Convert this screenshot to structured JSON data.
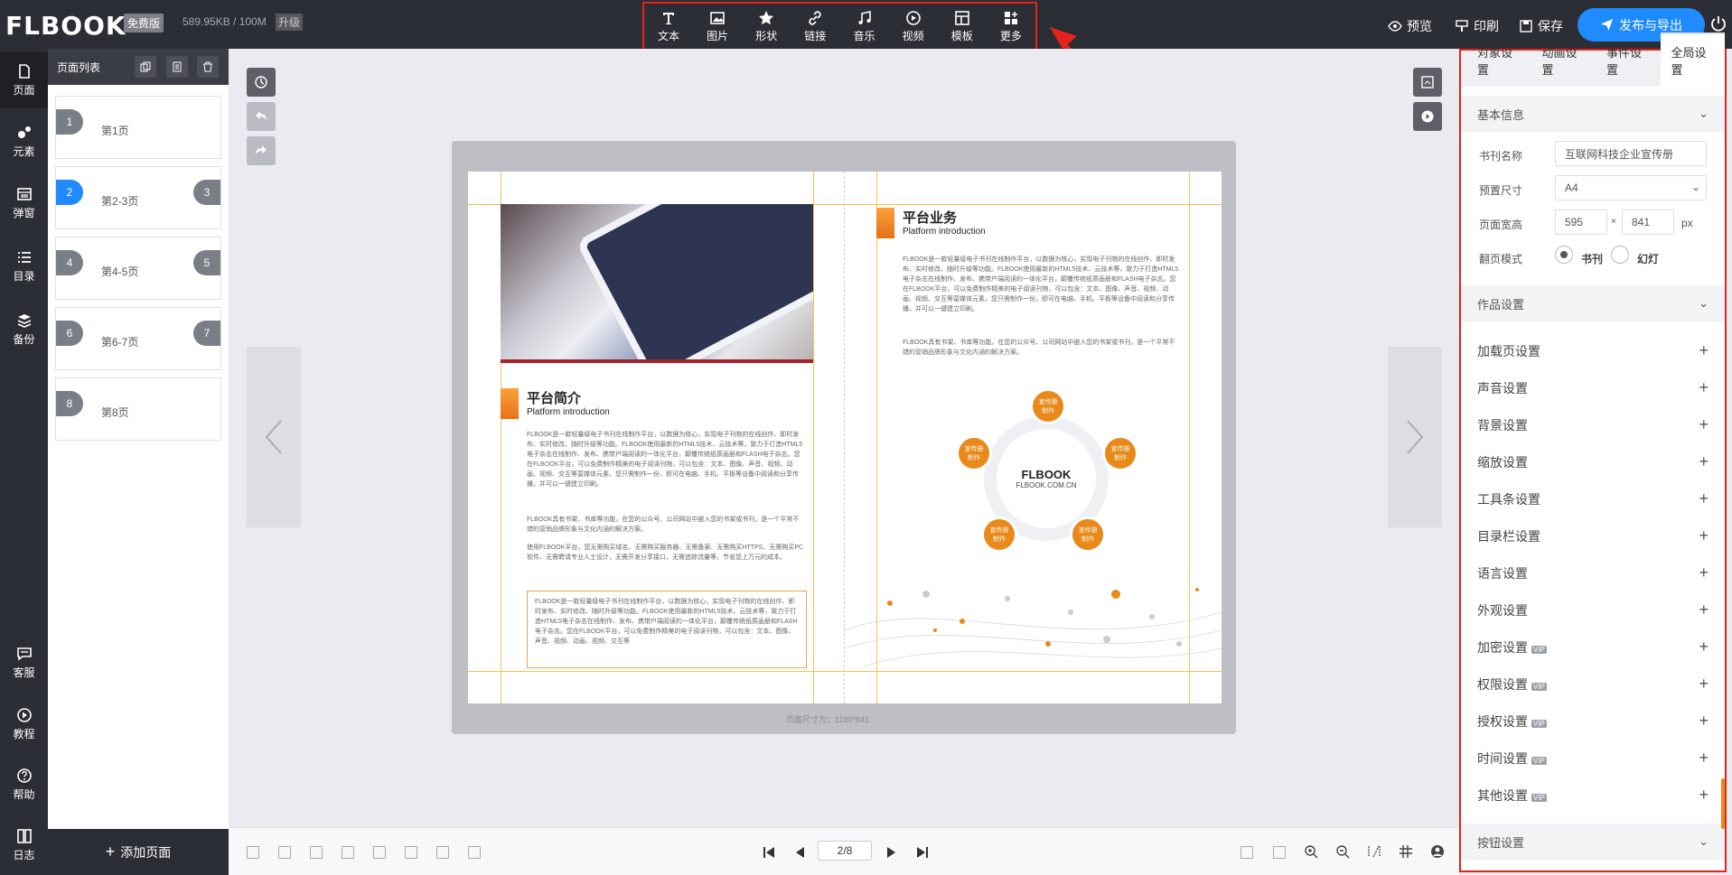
{
  "header": {
    "logo": "FLBOOK",
    "plan_badge": "免费版",
    "storage": "589.95KB / 100M",
    "upgrade": "升级",
    "tools": [
      {
        "label": "文本",
        "icon": "text-icon"
      },
      {
        "label": "图片",
        "icon": "image-icon"
      },
      {
        "label": "形状",
        "icon": "star-icon"
      },
      {
        "label": "链接",
        "icon": "link-icon"
      },
      {
        "label": "音乐",
        "icon": "music-icon"
      },
      {
        "label": "视频",
        "icon": "video-icon"
      },
      {
        "label": "模板",
        "icon": "template-icon"
      },
      {
        "label": "更多",
        "icon": "more-icon"
      }
    ],
    "preview": "预览",
    "print": "印刷",
    "save": "保存",
    "publish": "发布与导出"
  },
  "sidebar": {
    "items": [
      {
        "label": "页面",
        "icon": "page-icon"
      },
      {
        "label": "元素",
        "icon": "element-icon"
      },
      {
        "label": "弹窗",
        "icon": "popup-icon"
      },
      {
        "label": "目录",
        "icon": "list-icon"
      },
      {
        "label": "备份",
        "icon": "stack-icon"
      }
    ],
    "bottom_items": [
      {
        "label": "客服",
        "icon": "chat-icon"
      },
      {
        "label": "教程",
        "icon": "play-icon"
      },
      {
        "label": "帮助",
        "icon": "help-icon"
      },
      {
        "label": "日志",
        "icon": "log-icon"
      }
    ]
  },
  "page_list": {
    "title": "页面列表",
    "pages": [
      {
        "num": "1",
        "label": "第1页",
        "num2": ""
      },
      {
        "num": "2",
        "label": "第2-3页",
        "num2": "3"
      },
      {
        "num": "4",
        "label": "第4-5页",
        "num2": "5"
      },
      {
        "num": "6",
        "label": "第6-7页",
        "num2": "7"
      },
      {
        "num": "8",
        "label": "第8页",
        "num2": ""
      }
    ],
    "add_page": "添加页面"
  },
  "book": {
    "left": {
      "title_cn": "平台简介",
      "title_en": "Platform introduction",
      "para1": "FLBOOK是一款轻量级电子书刊在线制作平台，以数据为核心，实现电子刊物的在线创作、即时发布、实时修改、随时升级等功能。FLBOOK使用最新的HTML5技术、云技术等，致力于打造HTML5电子杂志在线制作、发布、携带户端阅读的一体化平台，颠覆传统纸质画册和FLASH电子杂志。您在FLBOOK平台，可以免费制作精美的电子阅读刊物，可以包含：文本、图像、声音、视频、动画、视频、交互等富媒体元素。您只需制作一份，即可在电脑、手机、平板等设备中阅读和分享传播，并可以一键建立印刷。",
      "para2": "FLBOOK具有书架、书库等功能，在您的公众号、公司网站中嵌入您的书架或书刊，是一个平常不错的营销品牌形象与文化内涵的解决方案。",
      "para3": "使用FLBOOK平台，您无需购买域名、无需购买服务器、无需备案、无需购买HTTPS、无需购买PC软件、无需聘请专业人士设计，无需开发分享接口，无需追踪流量等，节省您上万元的成本。",
      "box_text": "FLBOOK是一款轻量级电子书刊在线制作平台，以数据为核心，实现电子刊物的在线创作、即时发布、实时修改、随时升级等功能。FLBOOK使用最新的HTML5技术、云技术等，致力于打造HTML5电子杂志在线制作、发布、携带户端阅读的一体化平台，颠覆传统纸质画册和FLASH电子杂志。您在FLBOOK平台，可以免费制作精美的电子阅读刊物，可以包含：文本、图像、声音、视频、动画、视频、交互等"
    },
    "right": {
      "title_cn": "平台业务",
      "title_en": "Platform introduction",
      "para1": "FLBOOK是一款轻量级电子书刊在线制作平台，以数据为核心，实现电子刊物的在线创作、即时发布、实时修改、随时升级等功能。FLBOOK使用最新的HTML5技术、云技术等，致力于打造HTML5电子杂志在线制作、发布、携带户端阅读的一体化平台，颠覆传统纸质画册和FLASH电子杂志。您在FLBOOK平台，可以免费制作精美的电子阅读刊物，可以包含：文本、图像、声音、视频、动画、视频、交互等富媒体元素。您只需制作一份，即可在电脑、手机、平板等设备中阅读和分享传播，并可以一键建立印刷。",
      "para2": "FLBOOK具有书架、书库等功能，在您的公众号、公司网站中嵌入您的书架或书刊，是一个平常不错的营销品牌形象与文化内涵的解决方案。",
      "center_logo": "FLBOOK",
      "center_url": "FLBOOK.COM.CN",
      "node_label": "宣传册制作"
    },
    "size_label": "页面尺寸为：1190*841"
  },
  "bottom": {
    "page_indicator": "2/8"
  },
  "right_panel": {
    "tabs": [
      "对象设置",
      "动画设置",
      "事件设置",
      "全局设置"
    ],
    "active_tab": "全局设置",
    "basic_info": "基本信息",
    "fields": {
      "name_label": "书刊名称",
      "name_value": "互联网科技企业宣传册",
      "size_label": "预置尺寸",
      "size_value": "A4",
      "wh_label": "页面宽高",
      "width": "595",
      "height": "841",
      "times": "×",
      "unit": "px",
      "flip_label": "翻页模式",
      "flip_book": "书刊",
      "flip_slide": "幻灯"
    },
    "work_settings": "作品设置",
    "settings": [
      {
        "label": "加载页设置",
        "vip": ""
      },
      {
        "label": "声音设置",
        "vip": ""
      },
      {
        "label": "背景设置",
        "vip": ""
      },
      {
        "label": "缩放设置",
        "vip": ""
      },
      {
        "label": "工具条设置",
        "vip": ""
      },
      {
        "label": "目录栏设置",
        "vip": ""
      },
      {
        "label": "语言设置",
        "vip": ""
      },
      {
        "label": "外观设置",
        "vip": ""
      },
      {
        "label": "加密设置",
        "vip": "VIP"
      },
      {
        "label": "权限设置",
        "vip": "VIP"
      },
      {
        "label": "授权设置",
        "vip": "VIP"
      },
      {
        "label": "时间设置",
        "vip": "VIP"
      },
      {
        "label": "其他设置",
        "vip": "VIP"
      }
    ],
    "button_settings": "按钮设置"
  },
  "colors": {
    "accent": "#1f8bff",
    "highlight": "#e5231b",
    "orange": "#e8891a",
    "dark": "#2b2e34"
  }
}
